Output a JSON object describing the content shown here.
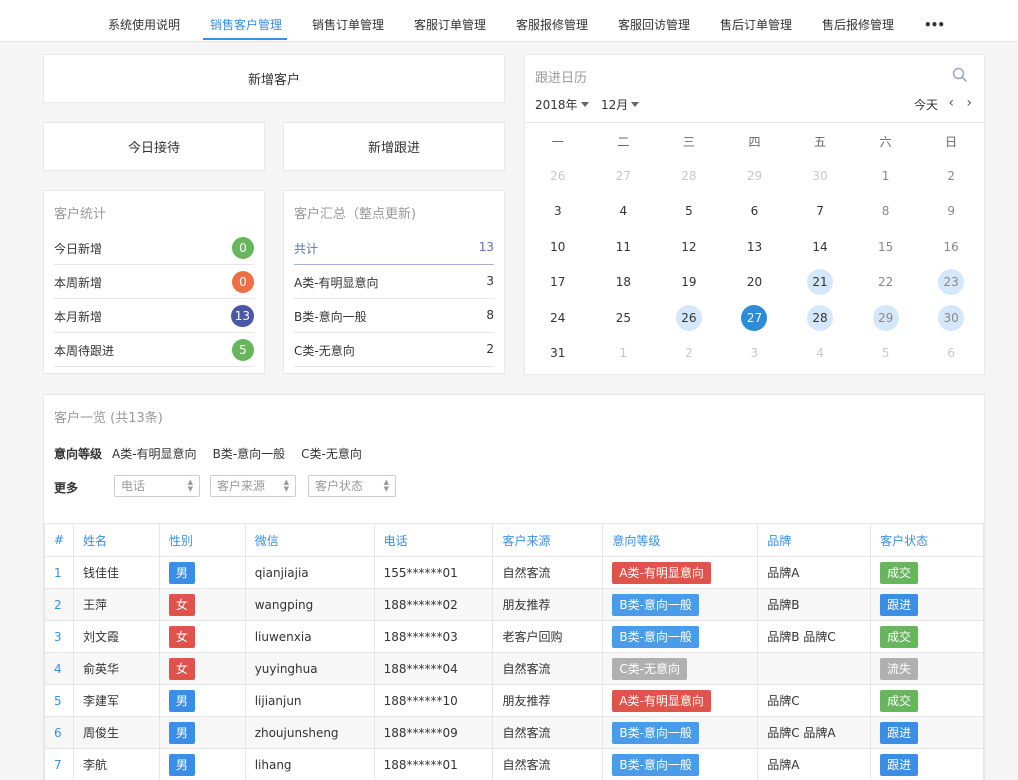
{
  "nav": {
    "tabs": [
      "系统使用说明",
      "销售客户管理",
      "销售订单管理",
      "客服订单管理",
      "客服报修管理",
      "客服回访管理",
      "售后订单管理",
      "售后报修管理"
    ],
    "more": "•••",
    "active_index": 1
  },
  "actions": {
    "new_customer": "新增客户",
    "today_reception": "今日接待",
    "new_followup": "新增跟进"
  },
  "customer_stats": {
    "title": "客户统计",
    "rows": [
      {
        "label": "今日新增",
        "value": "0",
        "color": "#67b55c"
      },
      {
        "label": "本周新增",
        "value": "0",
        "color": "#ee6f45"
      },
      {
        "label": "本月新增",
        "value": "13",
        "color": "#4957a6"
      },
      {
        "label": "本周待跟进",
        "value": "5",
        "color": "#67b55c"
      }
    ]
  },
  "customer_summary": {
    "title": "客户汇总（整点更新)",
    "total_label": "共计",
    "total_value": "13",
    "rows": [
      {
        "label": "A类-有明显意向",
        "value": "3"
      },
      {
        "label": "B类-意向一般",
        "value": "8"
      },
      {
        "label": "C类-无意向",
        "value": "2"
      }
    ]
  },
  "calendar": {
    "title": "跟进日历",
    "year": "2018年",
    "month": "12月",
    "today_label": "今天",
    "prev": "‹",
    "next": "›",
    "weekdays": [
      "一",
      "二",
      "三",
      "四",
      "五",
      "六",
      "日"
    ],
    "weeks": [
      [
        {
          "d": "26",
          "s": "muted"
        },
        {
          "d": "27",
          "s": "muted"
        },
        {
          "d": "28",
          "s": "muted"
        },
        {
          "d": "29",
          "s": "muted"
        },
        {
          "d": "30",
          "s": "muted"
        },
        {
          "d": "1",
          "s": "weekend"
        },
        {
          "d": "2",
          "s": "weekend"
        }
      ],
      [
        {
          "d": "3",
          "s": ""
        },
        {
          "d": "4",
          "s": ""
        },
        {
          "d": "5",
          "s": ""
        },
        {
          "d": "6",
          "s": ""
        },
        {
          "d": "7",
          "s": ""
        },
        {
          "d": "8",
          "s": "weekend"
        },
        {
          "d": "9",
          "s": "weekend"
        }
      ],
      [
        {
          "d": "10",
          "s": ""
        },
        {
          "d": "11",
          "s": ""
        },
        {
          "d": "12",
          "s": ""
        },
        {
          "d": "13",
          "s": ""
        },
        {
          "d": "14",
          "s": ""
        },
        {
          "d": "15",
          "s": "weekend"
        },
        {
          "d": "16",
          "s": "weekend"
        }
      ],
      [
        {
          "d": "17",
          "s": ""
        },
        {
          "d": "18",
          "s": ""
        },
        {
          "d": "19",
          "s": ""
        },
        {
          "d": "20",
          "s": ""
        },
        {
          "d": "21",
          "s": "hl"
        },
        {
          "d": "22",
          "s": "weekend"
        },
        {
          "d": "23",
          "s": "weekend hl"
        }
      ],
      [
        {
          "d": "24",
          "s": ""
        },
        {
          "d": "25",
          "s": ""
        },
        {
          "d": "26",
          "s": "hl"
        },
        {
          "d": "27",
          "s": "today"
        },
        {
          "d": "28",
          "s": "hl"
        },
        {
          "d": "29",
          "s": "weekend hl"
        },
        {
          "d": "30",
          "s": "weekend hl"
        }
      ],
      [
        {
          "d": "31",
          "s": ""
        },
        {
          "d": "1",
          "s": "muted"
        },
        {
          "d": "2",
          "s": "muted"
        },
        {
          "d": "3",
          "s": "muted"
        },
        {
          "d": "4",
          "s": "muted"
        },
        {
          "d": "5",
          "s": "muted"
        },
        {
          "d": "6",
          "s": "muted"
        }
      ]
    ]
  },
  "customer_list": {
    "title": "客户一览 (共13条)",
    "intent_label": "意向等级",
    "intent_options": [
      "A类-有明显意向",
      "B类-意向一般",
      "C类-无意向"
    ],
    "more_label": "更多",
    "filters": [
      "电话",
      "客户来源",
      "客户状态"
    ],
    "columns": [
      "#",
      "姓名",
      "性别",
      "微信",
      "电话",
      "客户来源",
      "意向等级",
      "品牌",
      "客户状态"
    ],
    "colors": {
      "male": "#3a8ee6",
      "female": "#e0534a",
      "intent_a": "#e0534a",
      "intent_b": "#4a9be8",
      "intent_c": "#b0b0b0",
      "deal": "#67b55c",
      "follow": "#3a8ee6",
      "lost": "#b0b0b0"
    },
    "rows": [
      {
        "no": "1",
        "name": "钱佳佳",
        "gender": "男",
        "wechat": "qianjiajia",
        "phone": "155******01",
        "source": "自然客流",
        "intent": "A类-有明显意向",
        "brand": "品牌A",
        "status": "成交"
      },
      {
        "no": "2",
        "name": "王萍",
        "gender": "女",
        "wechat": "wangping",
        "phone": "188******02",
        "source": "朋友推荐",
        "intent": "B类-意向一般",
        "brand": "品牌B",
        "status": "跟进"
      },
      {
        "no": "3",
        "name": "刘文霞",
        "gender": "女",
        "wechat": "liuwenxia",
        "phone": "188******03",
        "source": "老客户回购",
        "intent": "B类-意向一般",
        "brand": "品牌B 品牌C",
        "status": "成交"
      },
      {
        "no": "4",
        "name": "俞英华",
        "gender": "女",
        "wechat": "yuyinghua",
        "phone": "188******04",
        "source": "自然客流",
        "intent": "C类-无意向",
        "brand": "",
        "status": "流失"
      },
      {
        "no": "5",
        "name": "李建军",
        "gender": "男",
        "wechat": "lijianjun",
        "phone": "188******10",
        "source": "朋友推荐",
        "intent": "A类-有明显意向",
        "brand": "品牌C",
        "status": "成交"
      },
      {
        "no": "6",
        "name": "周俊生",
        "gender": "男",
        "wechat": "zhoujunsheng",
        "phone": "188******09",
        "source": "自然客流",
        "intent": "B类-意向一般",
        "brand": "品牌C 品牌A",
        "status": "跟进"
      },
      {
        "no": "7",
        "name": "李航",
        "gender": "男",
        "wechat": "lihang",
        "phone": "188******01",
        "source": "自然客流",
        "intent": "B类-意向一般",
        "brand": "品牌A",
        "status": "跟进"
      }
    ]
  }
}
